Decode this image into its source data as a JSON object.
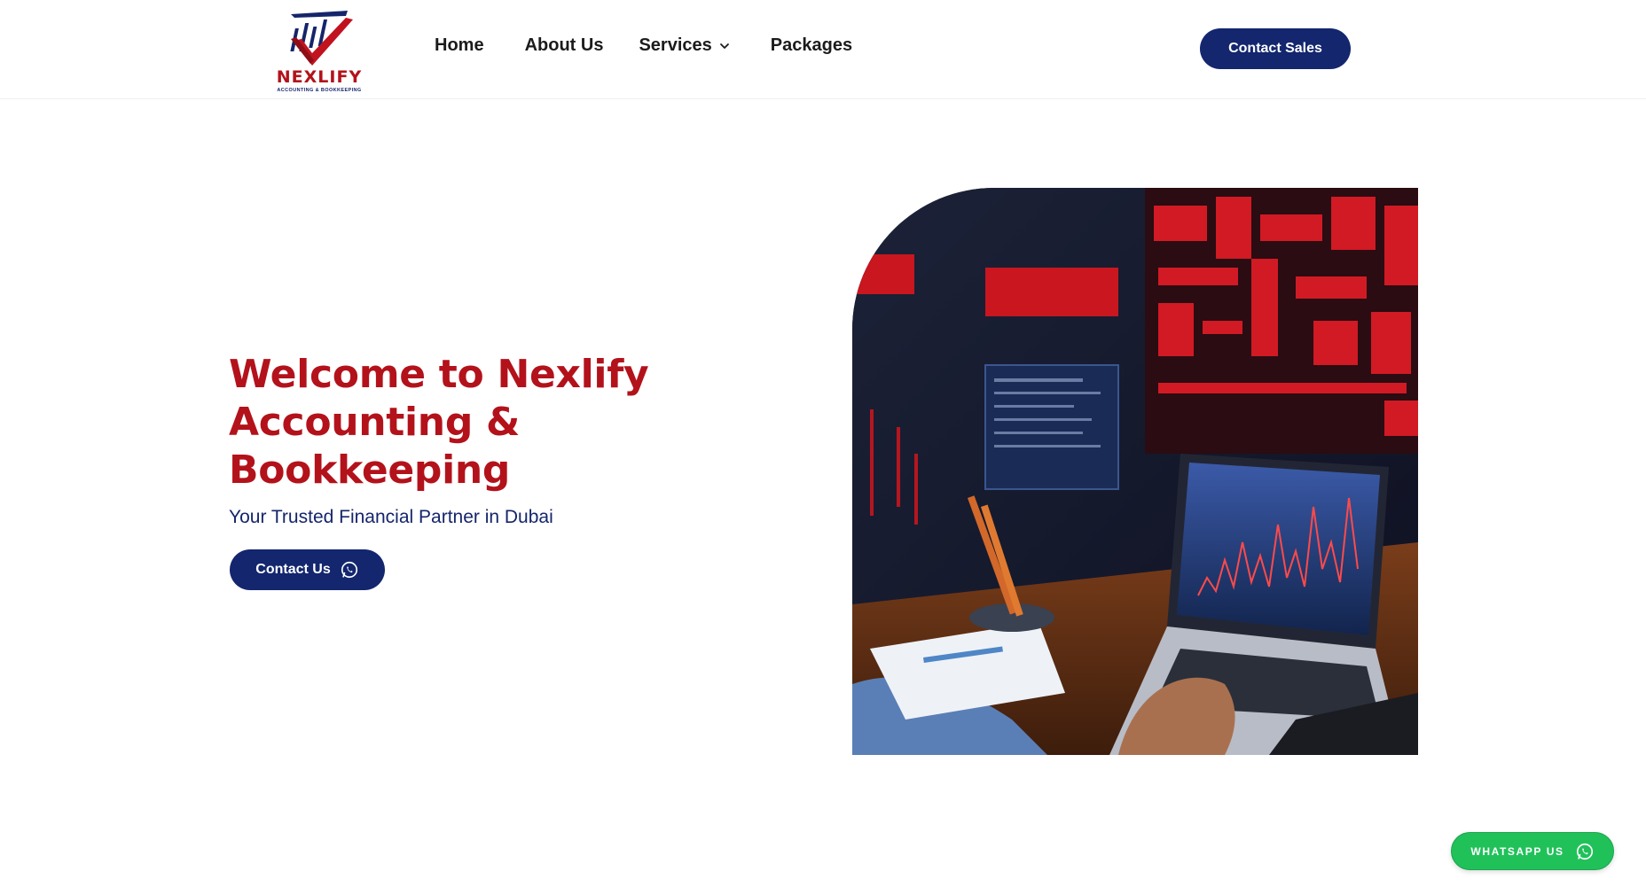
{
  "brand": {
    "name": "NEXLIFY",
    "tagline": "ACCOUNTING & BOOKKEEPING",
    "primary_color": "#13266e",
    "accent_color": "#b3121b",
    "whatsapp_color": "#21c15a"
  },
  "nav": {
    "items": [
      {
        "label": "Home"
      },
      {
        "label": "About Us"
      },
      {
        "label": "Services",
        "has_dropdown": true
      },
      {
        "label": "Packages"
      }
    ],
    "cta_label": "Contact Sales"
  },
  "hero": {
    "title": "Welcome to Nexlify Accounting & Bookkeeping",
    "subtitle": "Your Trusted Financial Partner in Dubai",
    "cta_label": "Contact Us",
    "image_icon": "accounting-dashboard-photo"
  },
  "floating": {
    "whatsapp_label": "WHATSAPP US"
  }
}
